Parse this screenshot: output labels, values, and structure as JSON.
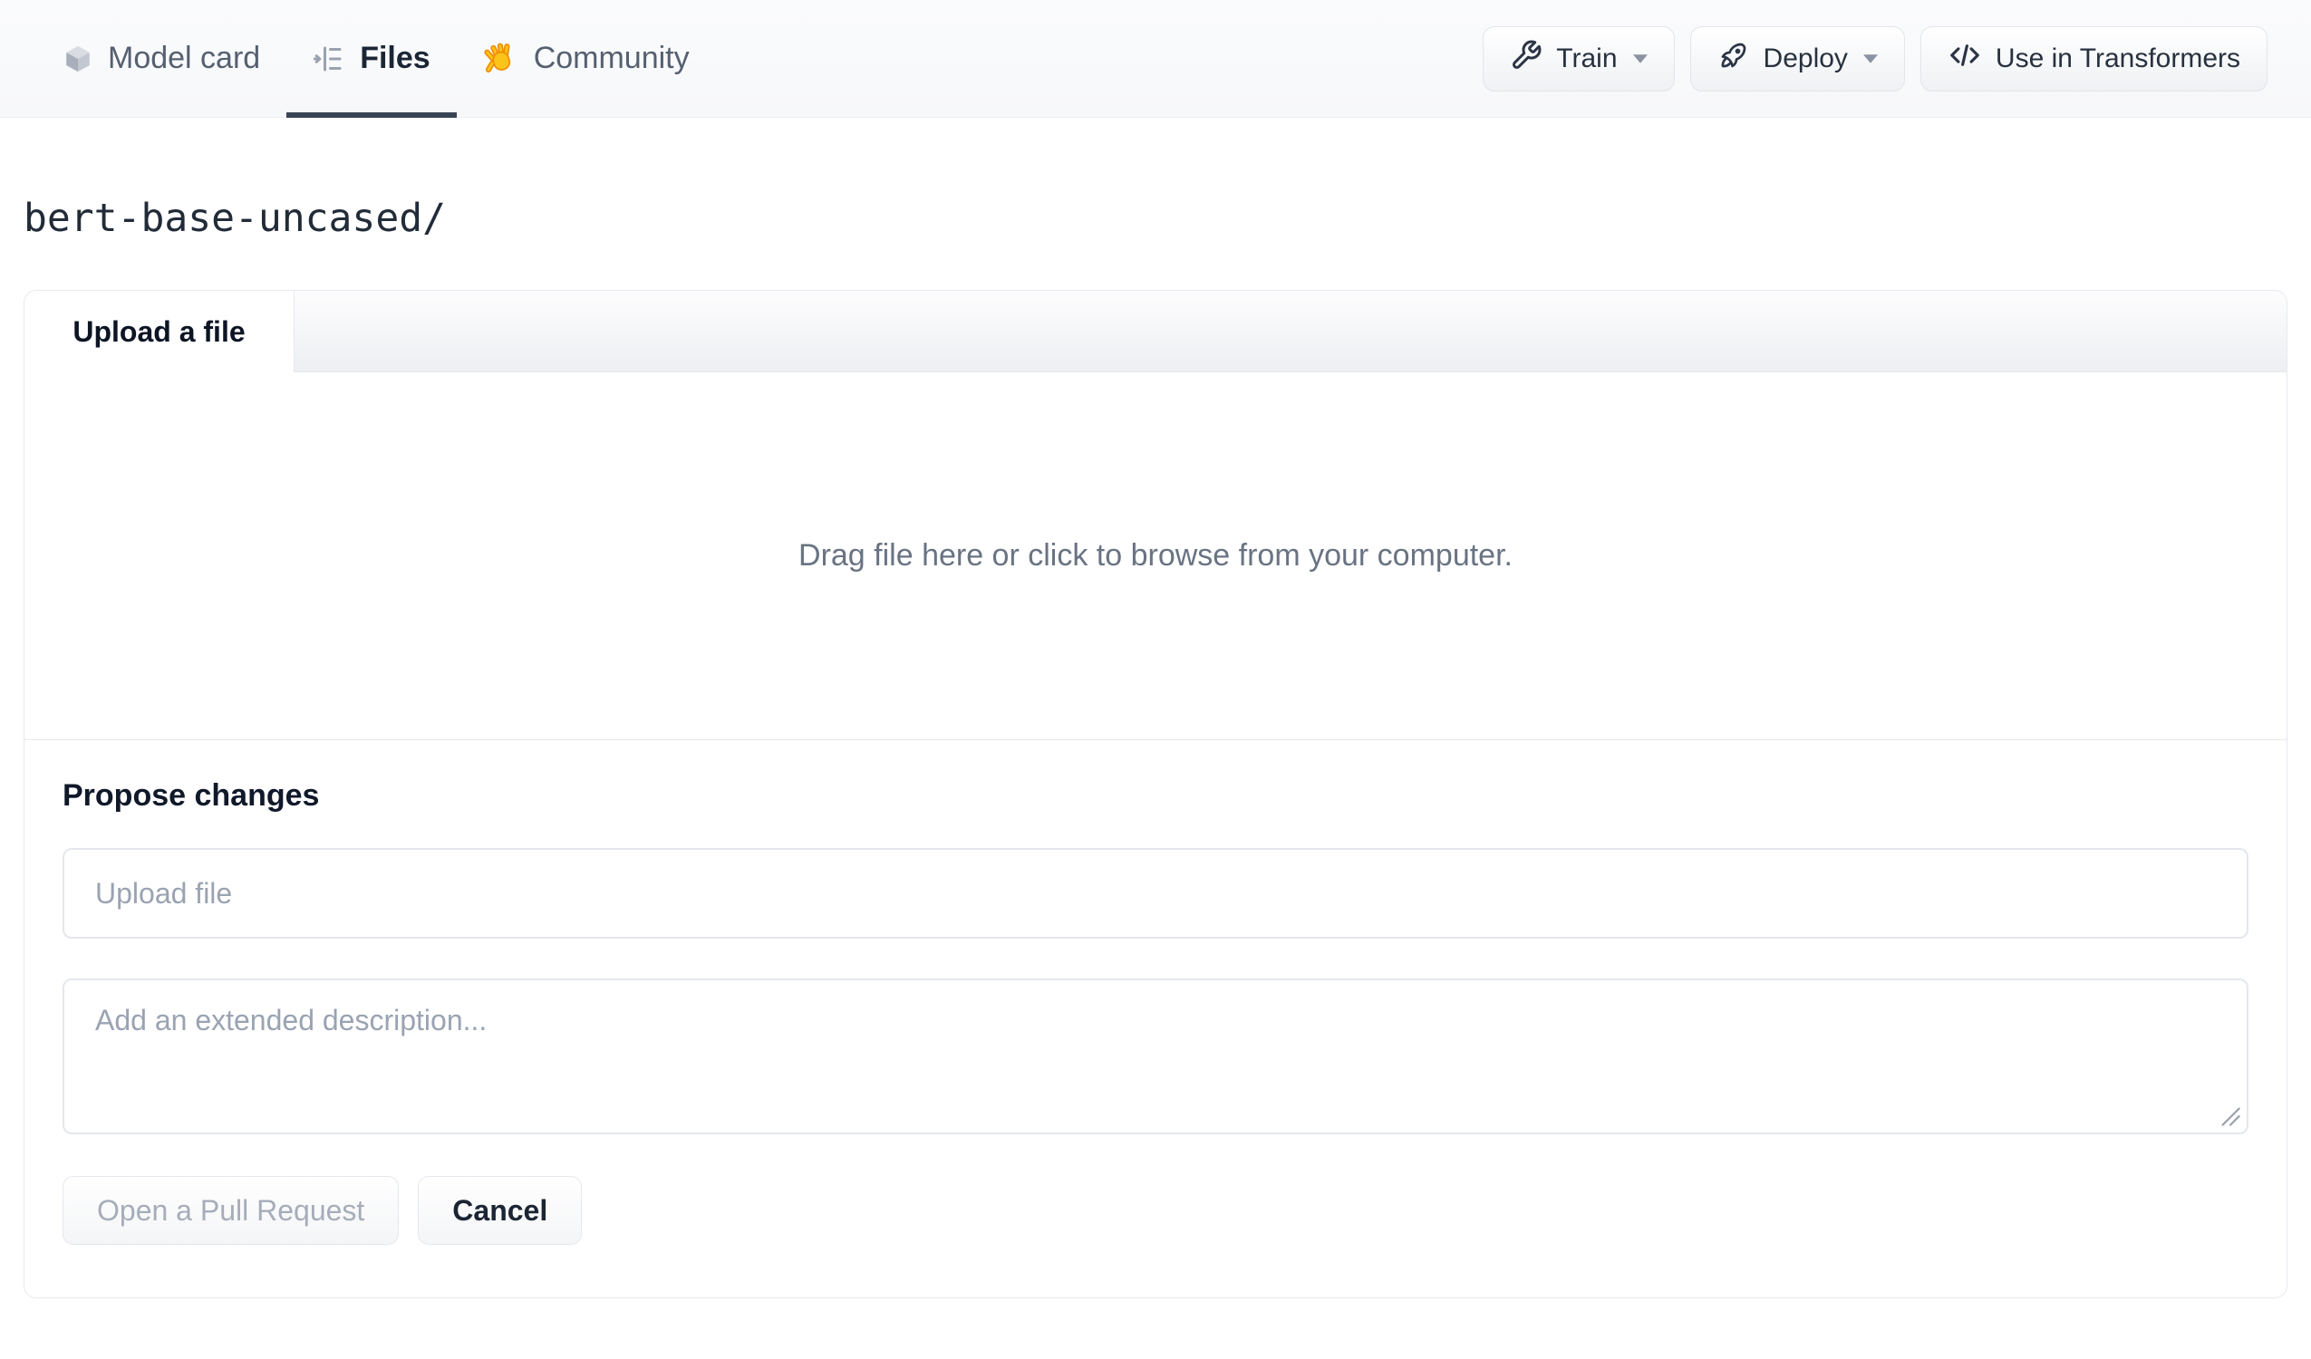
{
  "nav": {
    "tabs": [
      {
        "label": "Model card",
        "icon": "cube-icon",
        "active": false
      },
      {
        "label": "Files",
        "icon": "files-list-icon",
        "active": true
      },
      {
        "label": "Community",
        "icon": "waving-hand-icon",
        "active": false
      }
    ],
    "actions": [
      {
        "label": "Train",
        "icon": "wrench-icon",
        "caret": true
      },
      {
        "label": "Deploy",
        "icon": "rocket-icon",
        "caret": true
      },
      {
        "label": "Use in Transformers",
        "icon": "code-icon",
        "caret": false
      }
    ]
  },
  "breadcrumb": {
    "path": "bert-base-uncased/"
  },
  "upload_panel": {
    "tab_label": "Upload a file",
    "dropzone_text": "Drag file here or click to browse from your computer.",
    "propose": {
      "heading": "Propose changes",
      "filename_placeholder": "Upload file",
      "description_placeholder": "Add an extended description...",
      "primary_button": "Open a Pull Request",
      "cancel_button": "Cancel"
    }
  },
  "colors": {
    "active_tab_underline": "#384454",
    "nav_background": "#f8f9fb",
    "panel_border": "#e7e9ee",
    "muted_text": "#697382",
    "placeholder_text": "#9aa3b2",
    "disabled_button_text": "#a6adb9",
    "hand_emoji_yellow": "#fcc419"
  }
}
